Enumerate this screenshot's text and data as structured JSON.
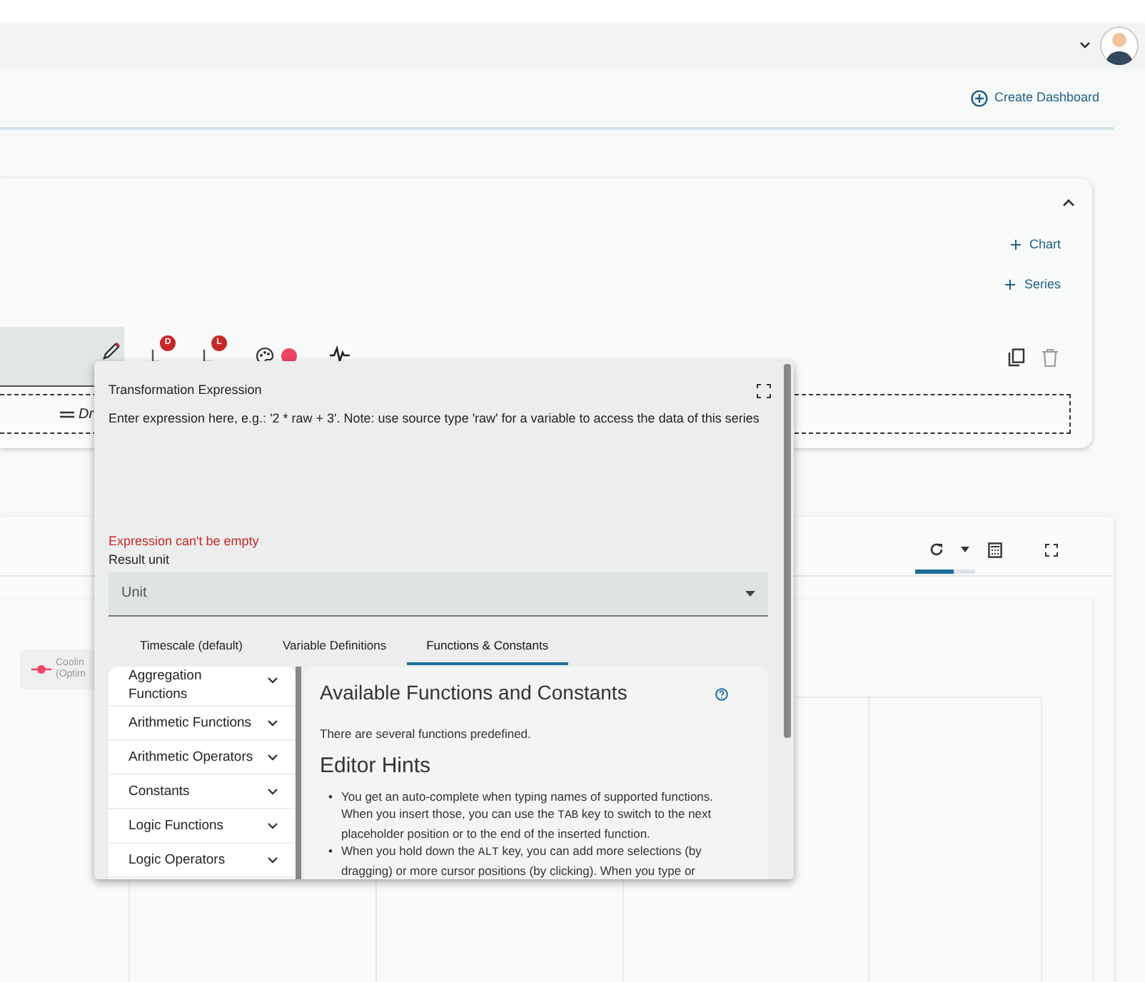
{
  "header": {
    "create_dashboard": "Create Dashboard"
  },
  "editor_card": {
    "add_buttons": [
      "Chart",
      "Series"
    ],
    "badges": [
      "D",
      "L"
    ],
    "color": "#ee4466",
    "legend_text": "Dr"
  },
  "chart_card": {
    "refresh_progress": {
      "level": 0.65
    },
    "legend": {
      "lines": [
        "Coolin",
        "(Optim"
      ],
      "color": "#ee4466"
    }
  },
  "dialog": {
    "title": "Transformation Expression",
    "placeholder": "Enter expression here, e.g.: '2 * raw + 3'. Note: use source type 'raw' for a variable to access the data of this series",
    "error": "Expression can't be empty",
    "unit_label": "Result unit",
    "unit_placeholder": "Unit",
    "tabs": [
      {
        "label": "Timescale (default)",
        "selected": false
      },
      {
        "label": "Variable Definitions",
        "selected": false
      },
      {
        "label": "Functions & Constants",
        "selected": true
      }
    ],
    "categories": [
      {
        "label": "Aggregation Functions",
        "expanded": false
      },
      {
        "label": "Arithmetic Functions",
        "expanded": false
      },
      {
        "label": "Arithmetic Operators",
        "expanded": false
      },
      {
        "label": "Constants",
        "expanded": false
      },
      {
        "label": "Logic Functions",
        "expanded": false
      },
      {
        "label": "Logic Operators",
        "expanded": false
      }
    ],
    "help": {
      "heading": "Available Functions and Constants",
      "intro": "There are several functions predefined.",
      "hints_heading": "Editor Hints",
      "hints": [
        {
          "bullet": "•",
          "parts": [
            {
              "kind": "text",
              "text": "You get an auto-complete when typing names of supported functions. When you insert those, you can use the "
            },
            {
              "kind": "key",
              "text": "TAB"
            },
            {
              "kind": "text",
              "text": " key to switch to the next placeholder position or to the end of the inserted function."
            }
          ]
        },
        {
          "bullet": "•",
          "parts": [
            {
              "kind": "text",
              "text": "When you hold down the "
            },
            {
              "kind": "key",
              "text": "ALT"
            },
            {
              "kind": "text",
              "text": " key, you can add more selections (by dragging) or more cursor positions (by clicking). When you type or"
            }
          ]
        }
      ]
    }
  }
}
